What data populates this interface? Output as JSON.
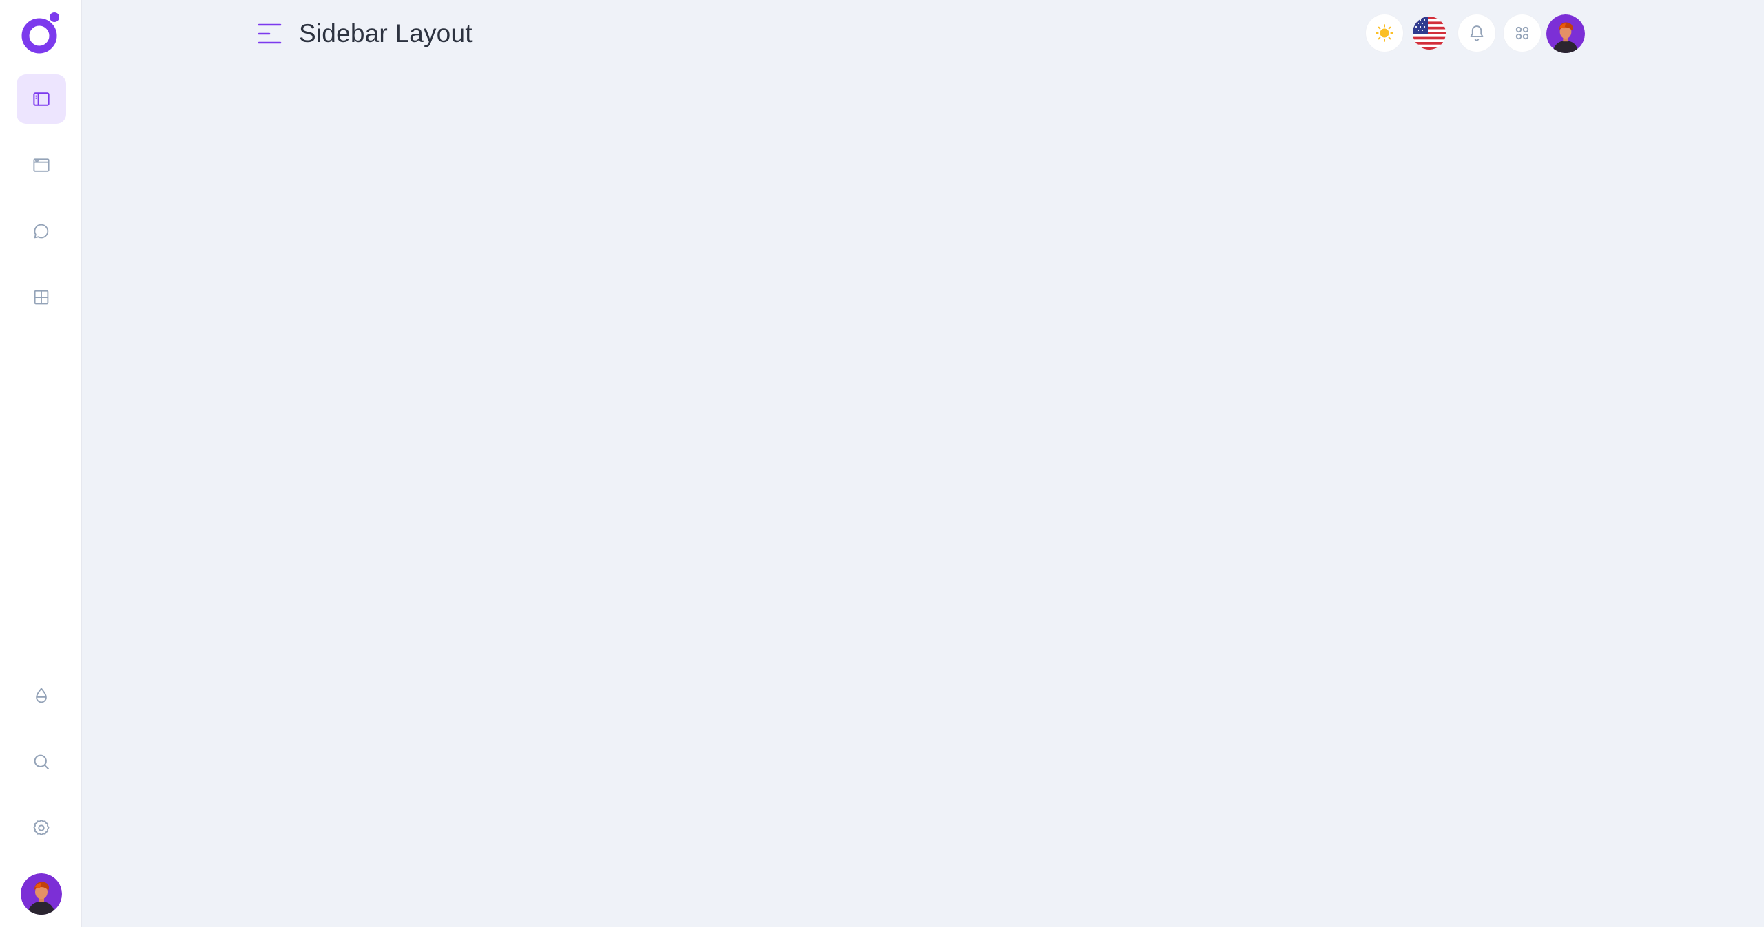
{
  "header": {
    "title": "Sidebar Layout"
  },
  "sidebar": {
    "top_items": [
      {
        "icon": "sidebar-layout-icon",
        "active": true
      },
      {
        "icon": "window-icon",
        "active": false
      },
      {
        "icon": "chat-bubble-icon",
        "active": false
      },
      {
        "icon": "grid-table-icon",
        "active": false
      }
    ],
    "bottom_items": [
      {
        "icon": "droplet-icon"
      },
      {
        "icon": "search-icon"
      },
      {
        "icon": "gear-icon"
      }
    ]
  },
  "header_actions": [
    {
      "icon": "sun-icon"
    },
    {
      "icon": "us-flag-icon"
    },
    {
      "icon": "bell-icon"
    },
    {
      "icon": "apps-grid-icon"
    },
    {
      "icon": "avatar"
    }
  ],
  "colors": {
    "accent": "#7c3aed",
    "active_bg": "#ede5fe",
    "icon": "#94a3b8",
    "sun": "#fbbf24",
    "background": "#eff2f8"
  }
}
